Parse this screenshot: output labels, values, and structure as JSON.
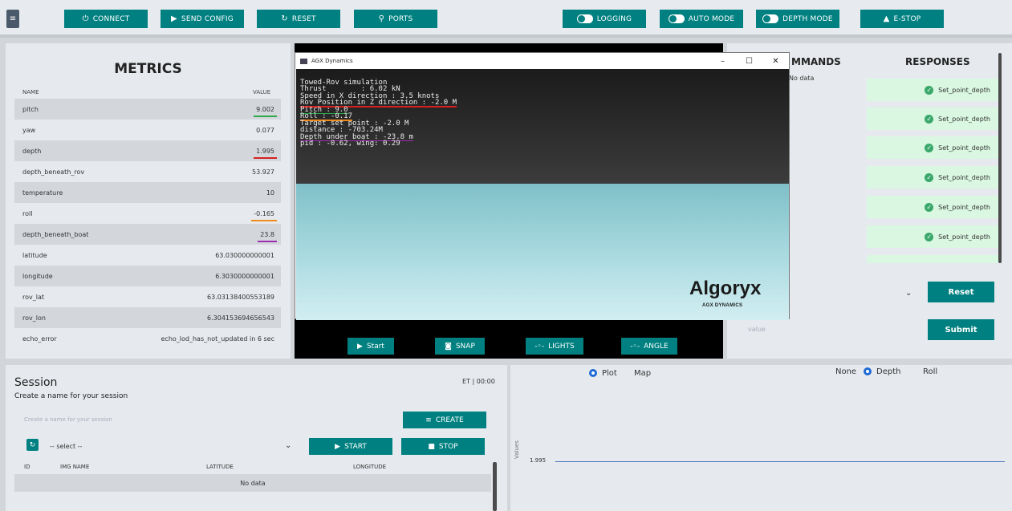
{
  "toolbar": {
    "connect": "CONNECT",
    "send_config": "SEND CONFIG",
    "reset": "RESET",
    "ports": "PORTS",
    "logging": "LOGGING",
    "auto_mode": "AUTO MODE",
    "depth_mode": "DEPTH MODE",
    "estop": "E-STOP"
  },
  "metrics": {
    "title": "METRICS",
    "col_name": "NAME",
    "col_value": "VALUE",
    "rows": [
      {
        "name": "pitch",
        "value": "9.002"
      },
      {
        "name": "yaw",
        "value": "0.077"
      },
      {
        "name": "depth",
        "value": "1.995"
      },
      {
        "name": "depth_beneath_rov",
        "value": "53.927"
      },
      {
        "name": "temperature",
        "value": "10"
      },
      {
        "name": "roll",
        "value": "-0.165"
      },
      {
        "name": "depth_beneath_boat",
        "value": "23.8"
      },
      {
        "name": "latitude",
        "value": "63.030000000001"
      },
      {
        "name": "longitude",
        "value": "6.3030000000001"
      },
      {
        "name": "rov_lat",
        "value": "63.03138400553189"
      },
      {
        "name": "rov_lon",
        "value": "6.304153694656543"
      },
      {
        "name": "echo_error",
        "value": "echo_lod_has_not_updated in 6 sec"
      }
    ]
  },
  "sim_window": {
    "title": "AGX Dynamics",
    "console": [
      "Towed-Rov simulation",
      "Thrust        : 6.02 kN",
      "Speed in X direction : 3.5 knots",
      "Rov Position in Z direction : -2.0 M",
      "Pitch : 9.0",
      "Roll : -0.17",
      "Target set point : -2.0 M",
      "distance : -703.24M",
      "Depth under boat : -23.8 m",
      "pid : -0.62, wing: 0.29"
    ],
    "logo": "Algoryx",
    "logo_sub": "AGX DYNAMICS",
    "controls": {
      "minimize": "–",
      "maximize": "☐",
      "close": "✕"
    }
  },
  "sim_buttons": {
    "start": "Start",
    "snap": "SNAP",
    "lights": "LIGHTS",
    "angle": "ANGLE"
  },
  "commands": {
    "title": "MMANDS",
    "empty": "No data",
    "value_placeholder": "value"
  },
  "responses": {
    "title": "RESPONSES",
    "items": [
      "Set_point_depth",
      "Set_point_depth",
      "Set_point_depth",
      "Set_point_depth",
      "Set_point_depth",
      "Set_point_depth"
    ]
  },
  "actions": {
    "reset": "Reset",
    "submit": "Submit"
  },
  "session": {
    "title": "Session",
    "et": "ET | 00:00",
    "subtitle": "Create a name for your session",
    "name_placeholder": "Create a name for your session",
    "create": "CREATE",
    "select": "-- select --",
    "start": "START",
    "stop": "STOP",
    "columns": [
      "ID",
      "IMG NAME",
      "LATITUDE",
      "LONGITUDE"
    ],
    "empty": "No data"
  },
  "plot": {
    "view_options": [
      "Plot",
      "Map"
    ],
    "selected_view": "Plot",
    "series_options": [
      "None",
      "Depth",
      "Roll"
    ],
    "selected_series": "Depth",
    "ylabel": "Values",
    "tick": "1.995",
    "line_color": "#4a78c2"
  },
  "colors": {
    "accent": "#008080",
    "underline_green": "#2aa84a",
    "underline_red": "#d62020",
    "underline_orange": "#f08a1c",
    "underline_purple": "#9b2fb0"
  }
}
